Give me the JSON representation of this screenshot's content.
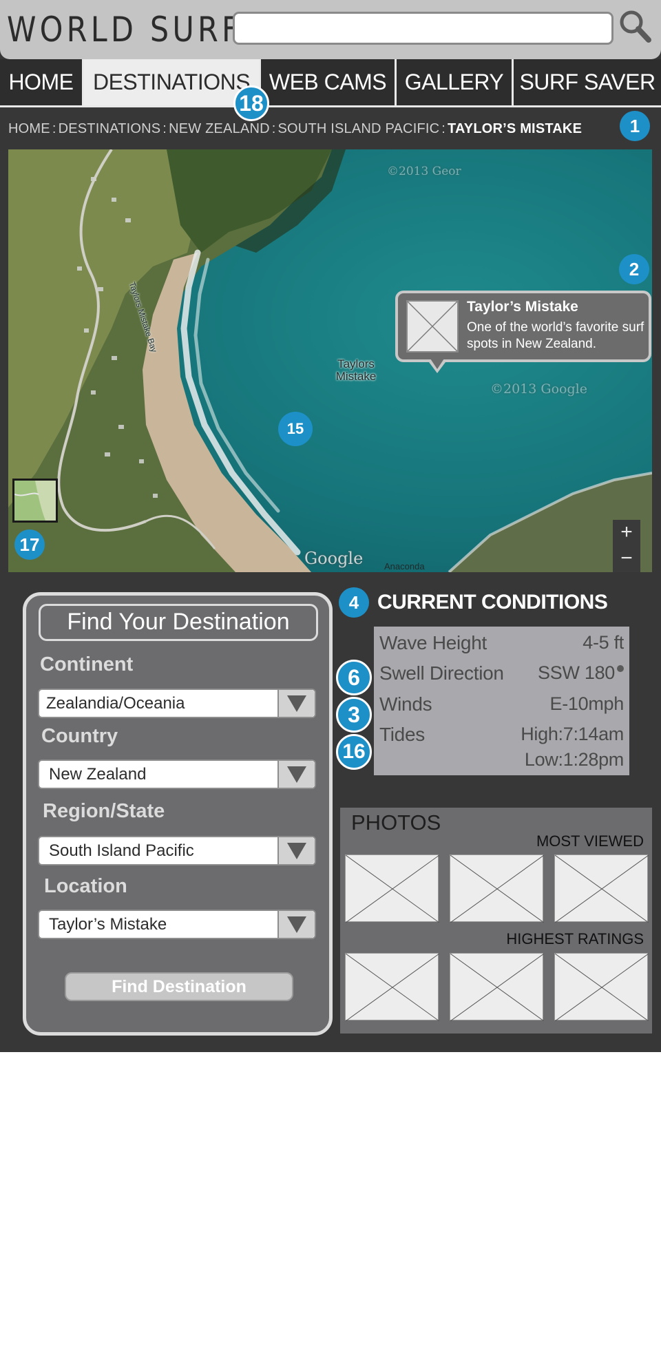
{
  "header": {
    "logo": "WORLD SURF",
    "search_value": "",
    "search_icon": "magnifier-icon"
  },
  "nav": {
    "tabs": [
      {
        "label": "HOME",
        "active": false
      },
      {
        "label": "DESTINATIONS",
        "active": true
      },
      {
        "label": "WEB CAMS",
        "active": false
      },
      {
        "label": "GALLERY",
        "active": false
      },
      {
        "label": "SURF SAVER",
        "active": false
      }
    ]
  },
  "breadcrumb": {
    "items": [
      "HOME",
      "DESTINATIONS",
      "NEW ZEALAND",
      "SOUTH ISLAND PACIFIC"
    ],
    "separator": ":",
    "current": "TAYLOR’S MISTAKE"
  },
  "callouts": {
    "breadcrumb": "1",
    "map_popup": "2",
    "winds": "3",
    "conditions": "4",
    "swell": "6",
    "map": "15",
    "tides": "16",
    "map_toggle": "17",
    "nav": "18"
  },
  "map": {
    "road_label": "Taylors Mistake Bay",
    "place_label": "Taylors Mistake",
    "watermark_top": "©2013 Geor",
    "watermark_right": "©2013 Google",
    "google_logo": "Google",
    "street_label": "Anaconda",
    "zoom_in": "+",
    "zoom_out": "−",
    "popup": {
      "title": "Taylor’s Mistake",
      "description": "One of the world’s favorite surf spots in New Zealand."
    }
  },
  "find": {
    "title": "Find Your Destination",
    "continent_label": "Continent",
    "continent_value": "Zealandia/Oceania",
    "country_label": "Country",
    "country_value": "New Zealand",
    "region_label": "Region/State",
    "region_value": "South Island Pacific",
    "location_label": "Location",
    "location_value": "Taylor’s Mistake",
    "button": "Find Destination"
  },
  "conditions": {
    "title": "CURRENT CONDITIONS",
    "wave_label": "Wave Height",
    "wave_value": "4-5 ft",
    "swell_label": "Swell Direction",
    "swell_value": "SSW 180",
    "winds_label": "Winds",
    "winds_value": "E-10mph",
    "tides_label": "Tides",
    "tides_high": "High:7:14am",
    "tides_low": "Low:1:28pm"
  },
  "photos": {
    "title": "PHOTOS",
    "most_viewed": "MOST VIEWED",
    "highest_ratings": "HIGHEST RATINGS"
  },
  "colors": {
    "badge": "#1e90c8",
    "background": "#373737",
    "header": "#c4c4c4",
    "panel": "#6c6c6f"
  }
}
